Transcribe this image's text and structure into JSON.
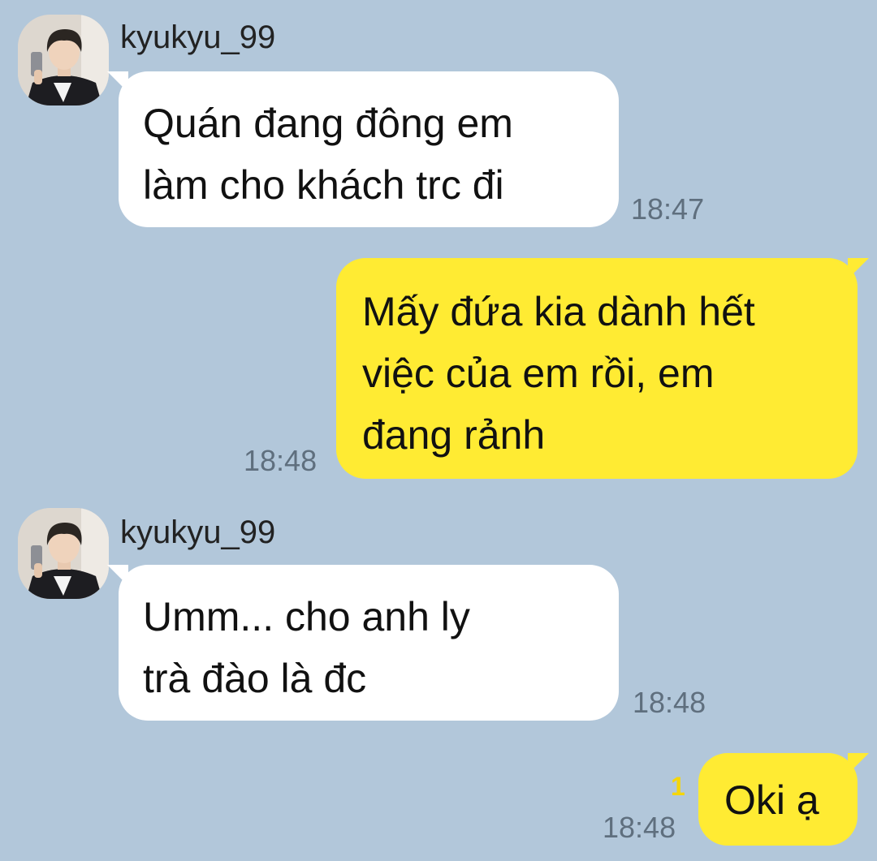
{
  "messages": [
    {
      "direction": "incoming",
      "sender": "kyukyu_99",
      "avatar_icon": "profile-photo",
      "text": "Quán đang đông em\nlàm cho khách trc đi",
      "time": "18:47"
    },
    {
      "direction": "outgoing",
      "text": "Mấy đứa kia dành hết\nviệc của em rồi, em\nđang rảnh",
      "time": "18:48"
    },
    {
      "direction": "incoming",
      "sender": "kyukyu_99",
      "avatar_icon": "profile-photo",
      "text": "Umm... cho anh ly\ntrà đào là đc",
      "time": "18:48"
    },
    {
      "direction": "outgoing",
      "text": "Oki ạ",
      "time": "18:48",
      "unread_count": "1"
    }
  ],
  "colors": {
    "background": "#b2c7da",
    "incoming_bubble": "#ffffff",
    "outgoing_bubble": "#ffeb33",
    "unread": "#f5d60a"
  }
}
